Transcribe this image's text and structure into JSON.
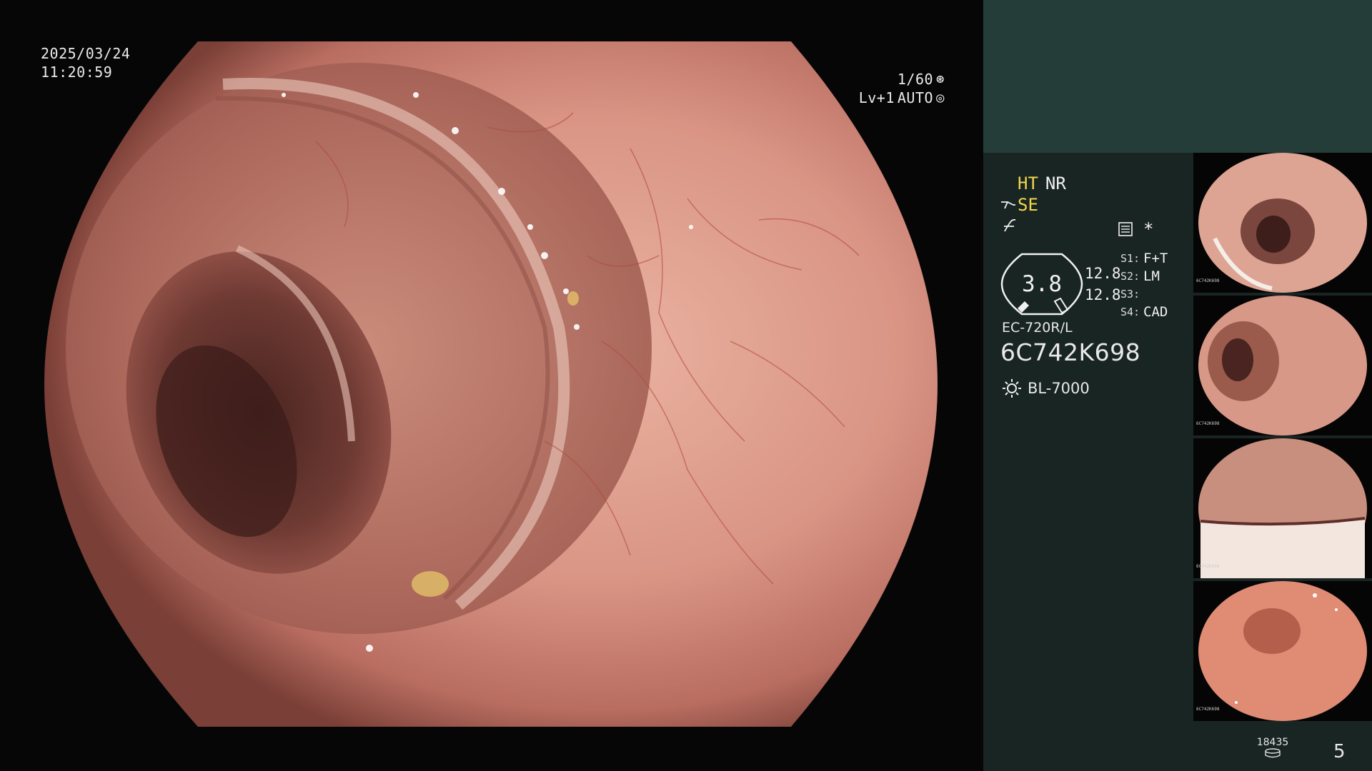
{
  "main_view": {
    "date": "2025/03/24",
    "time": "11:20:59",
    "shutter": "1/60",
    "shutter_icon": "shutter-icon",
    "enhance": "Lv+1",
    "iris": "AUTO",
    "iris_icon": "iris-auto-icon"
  },
  "panel": {
    "mode_ht": "HT",
    "mode_nr": "NR",
    "structure_label": "SE",
    "structure_icon": "structure-enhance-icon",
    "color_icon": "color-mode-icon",
    "menu_icon": "settings-menu-icon",
    "asterisk": "*",
    "gauge_value": "3.8",
    "gauge_top": "12.8",
    "gauge_bottom": "12.8",
    "switches": [
      {
        "key": "S1:",
        "value": "F+T"
      },
      {
        "key": "S2:",
        "value": "LM"
      },
      {
        "key": "S3:",
        "value": ""
      },
      {
        "key": "S4:",
        "value": "CAD"
      }
    ],
    "scope_model": "EC-720R/L",
    "scope_serial": "6C742K698",
    "light_icon": "light-source-icon",
    "light_source": "BL-7000",
    "capture_count": "18435",
    "capture_icon": "storage-disk-icon",
    "page_number": "5"
  },
  "colors": {
    "panel_bg": "#192523",
    "panel_header": "#243d38",
    "highlight_yellow": "#f2d64a",
    "tissue_pink": "#d4897a"
  },
  "thumbnails": [
    {
      "label": "6C742K698"
    },
    {
      "label": "6C742K698"
    },
    {
      "label": "6C742K698"
    },
    {
      "label": "6C742K698"
    }
  ]
}
